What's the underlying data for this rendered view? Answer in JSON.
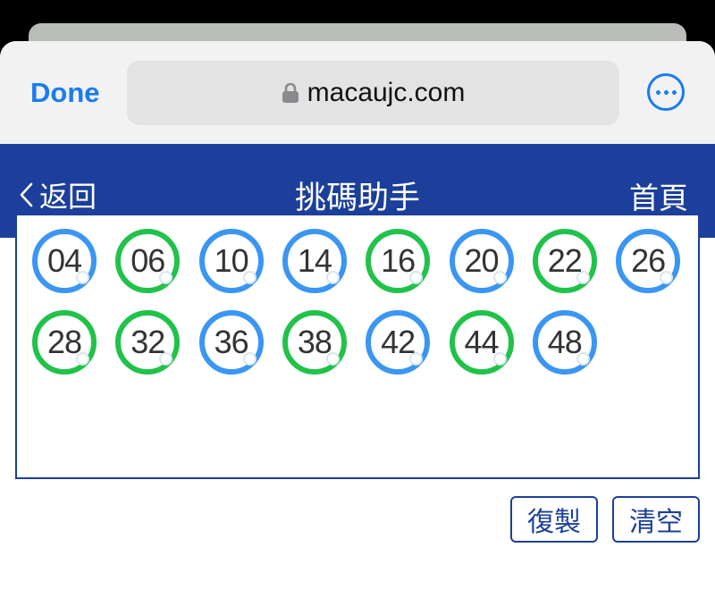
{
  "safari": {
    "done_label": "Done",
    "url": "macaujc.com",
    "lock_icon": "lock-icon",
    "more_icon": "ellipsis-circle-icon",
    "accent_color": "#1a7cf0"
  },
  "nav": {
    "back_label": "返回",
    "title": "挑碼助手",
    "home_label": "首頁",
    "bar_color": "#1b3f9a"
  },
  "balls": [
    {
      "number": "04",
      "color": "blue"
    },
    {
      "number": "06",
      "color": "green"
    },
    {
      "number": "10",
      "color": "blue"
    },
    {
      "number": "14",
      "color": "blue"
    },
    {
      "number": "16",
      "color": "green"
    },
    {
      "number": "20",
      "color": "blue"
    },
    {
      "number": "22",
      "color": "green"
    },
    {
      "number": "26",
      "color": "blue"
    },
    {
      "number": "28",
      "color": "green"
    },
    {
      "number": "32",
      "color": "green"
    },
    {
      "number": "36",
      "color": "blue"
    },
    {
      "number": "38",
      "color": "green"
    },
    {
      "number": "42",
      "color": "blue"
    },
    {
      "number": "44",
      "color": "green"
    },
    {
      "number": "48",
      "color": "blue"
    }
  ],
  "ball_colors": {
    "blue": "#3a96f2",
    "green": "#21c24a"
  },
  "actions": {
    "copy_label": "復製",
    "clear_label": "清空"
  }
}
